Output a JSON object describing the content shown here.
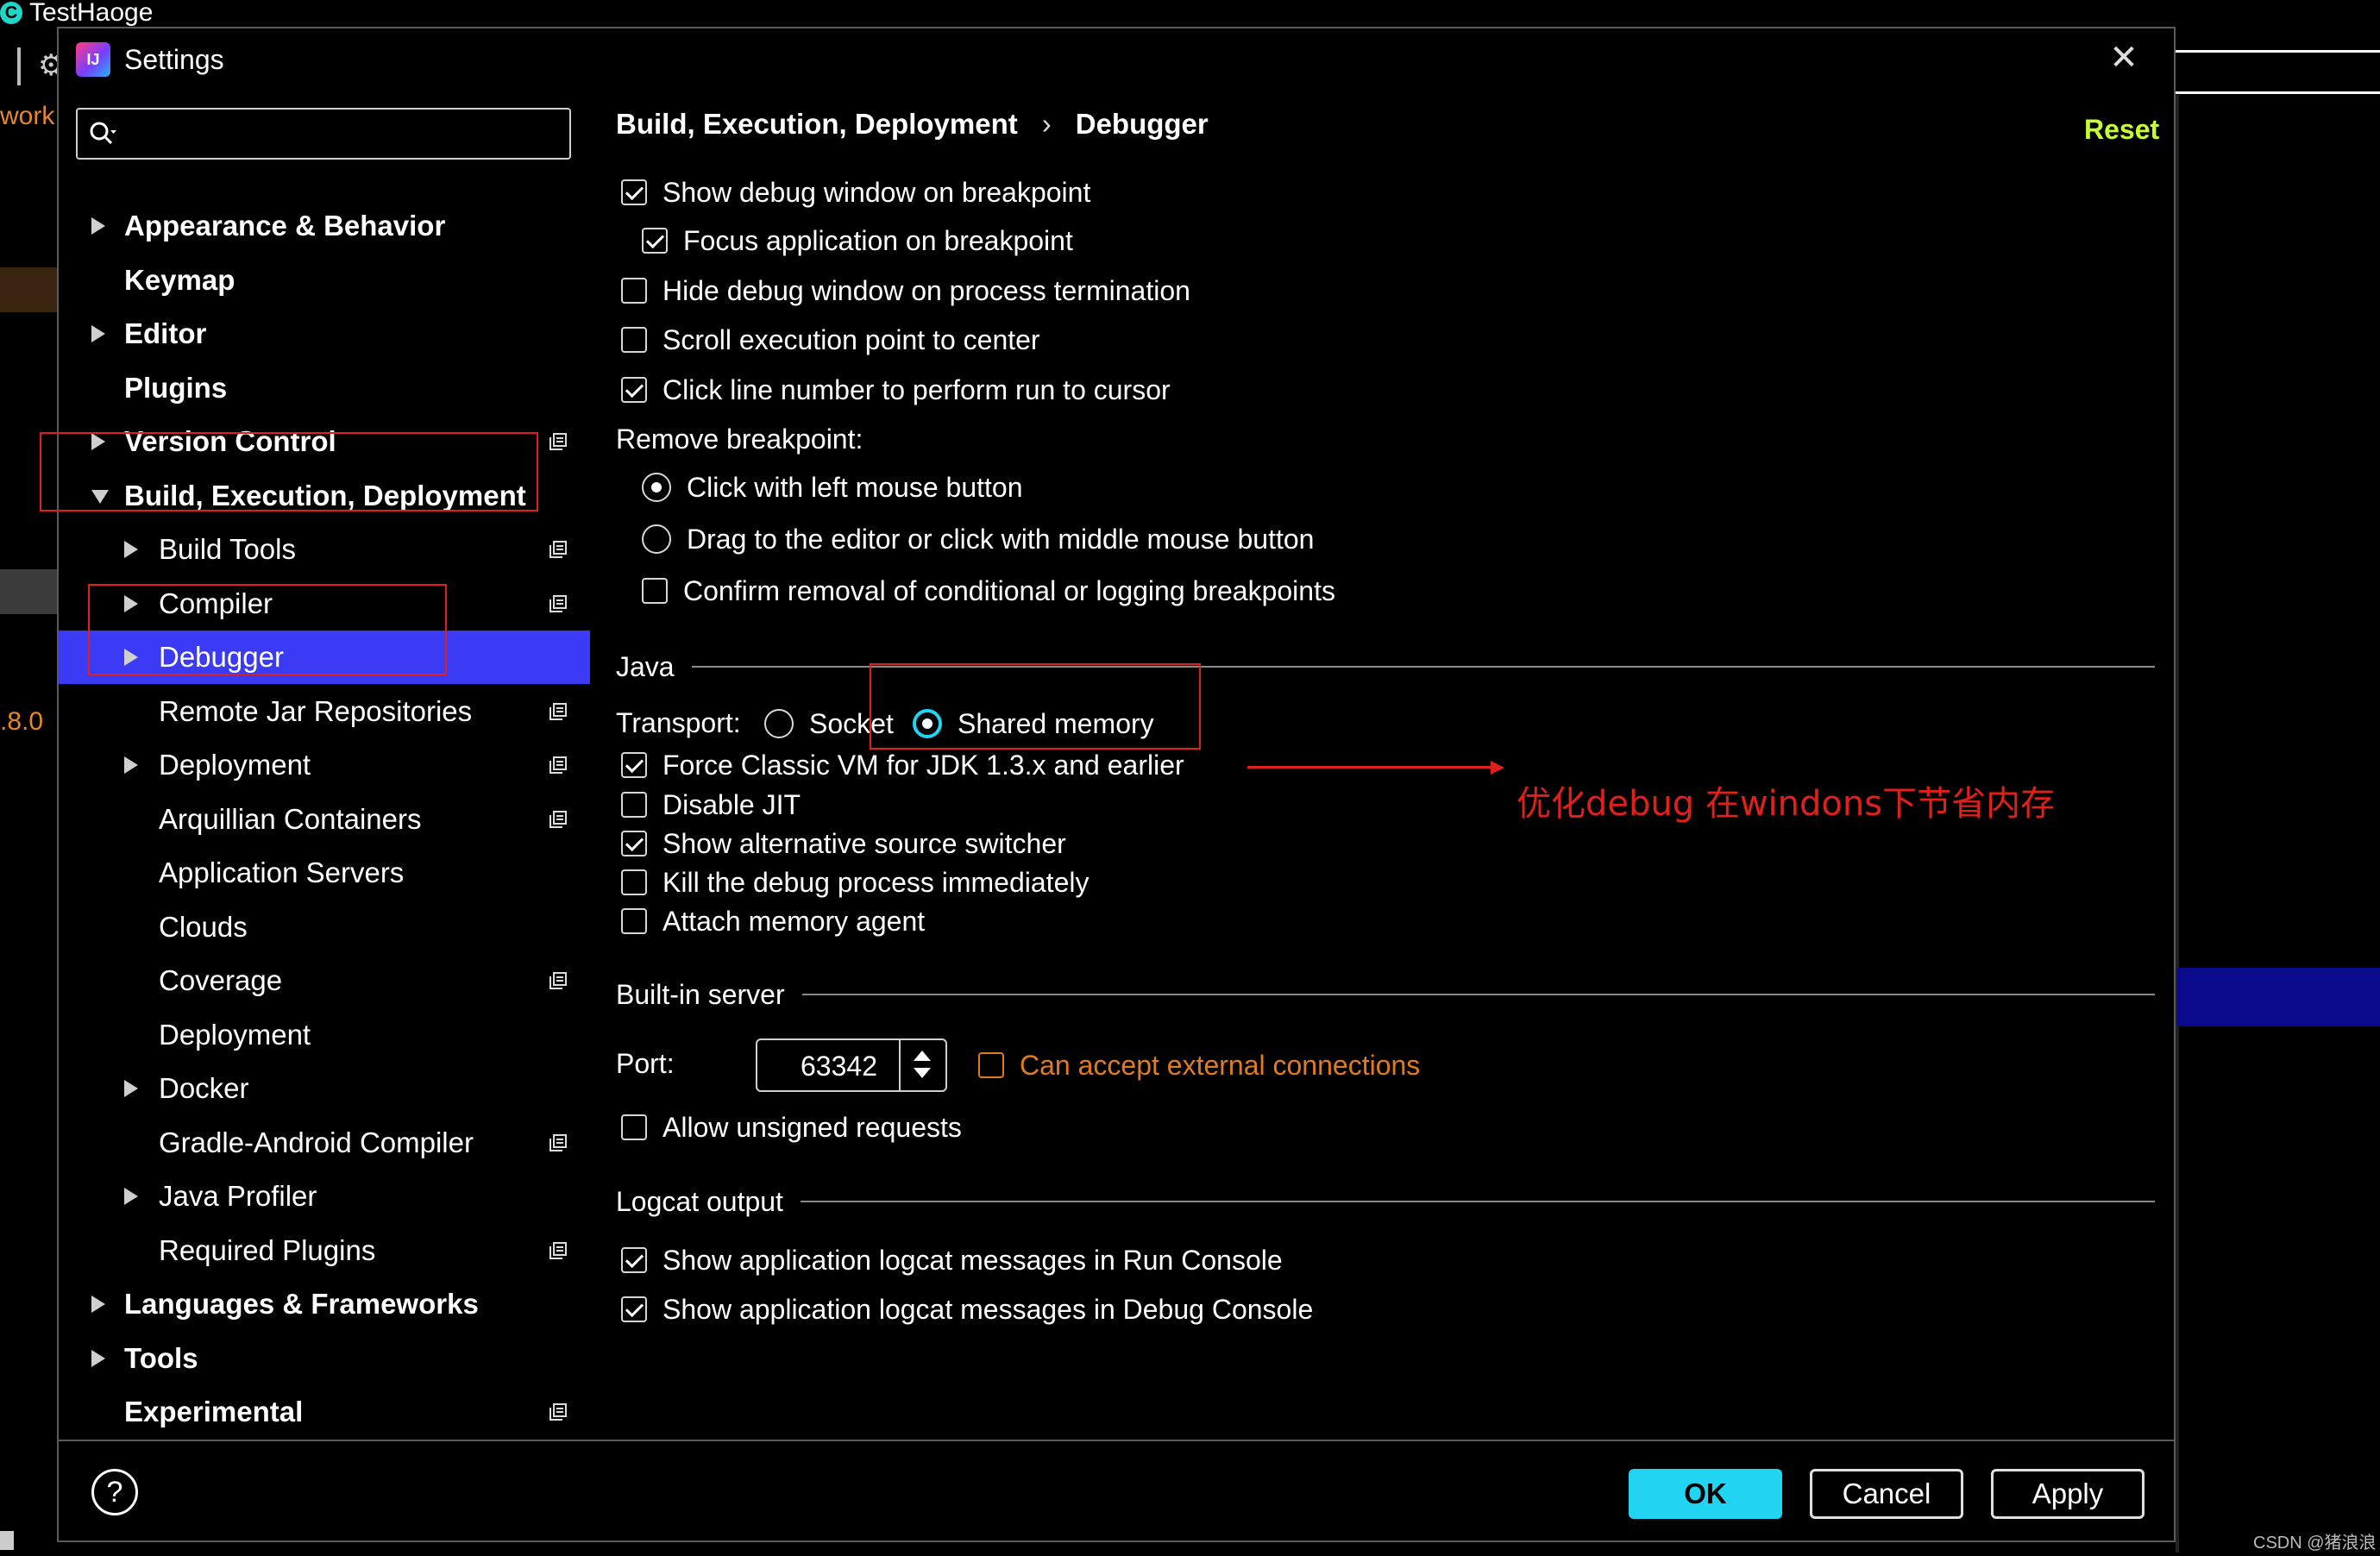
{
  "ide": {
    "title": "TestHaoge",
    "logo_letter": "C",
    "side_text_1": "work",
    "side_text_2": ".8.0"
  },
  "dialog": {
    "title": "Settings",
    "icon_text": "IJ",
    "close_glyph": "✕"
  },
  "search": {
    "placeholder": "",
    "value": ""
  },
  "tree": [
    {
      "label": "Appearance & Behavior",
      "bold": true,
      "level": 0,
      "arrow": "right",
      "copy": false
    },
    {
      "label": "Keymap",
      "bold": true,
      "level": 0,
      "arrow": "",
      "copy": false
    },
    {
      "label": "Editor",
      "bold": true,
      "level": 0,
      "arrow": "right",
      "copy": false
    },
    {
      "label": "Plugins",
      "bold": true,
      "level": 0,
      "arrow": "",
      "copy": false
    },
    {
      "label": "Version Control",
      "bold": true,
      "level": 0,
      "arrow": "right",
      "copy": true
    },
    {
      "label": "Build, Execution, Deployment",
      "bold": true,
      "level": 0,
      "arrow": "down",
      "copy": false
    },
    {
      "label": "Build Tools",
      "bold": false,
      "level": 1,
      "arrow": "right",
      "copy": true
    },
    {
      "label": "Compiler",
      "bold": false,
      "level": 1,
      "arrow": "right",
      "copy": true
    },
    {
      "label": "Debugger",
      "bold": false,
      "level": 1,
      "arrow": "right",
      "copy": false,
      "selected": true
    },
    {
      "label": "Remote Jar Repositories",
      "bold": false,
      "level": 1,
      "arrow": "",
      "copy": true
    },
    {
      "label": "Deployment",
      "bold": false,
      "level": 1,
      "arrow": "right",
      "copy": true
    },
    {
      "label": "Arquillian Containers",
      "bold": false,
      "level": 1,
      "arrow": "",
      "copy": true
    },
    {
      "label": "Application Servers",
      "bold": false,
      "level": 1,
      "arrow": "",
      "copy": false
    },
    {
      "label": "Clouds",
      "bold": false,
      "level": 1,
      "arrow": "",
      "copy": false
    },
    {
      "label": "Coverage",
      "bold": false,
      "level": 1,
      "arrow": "",
      "copy": true
    },
    {
      "label": "Deployment",
      "bold": false,
      "level": 1,
      "arrow": "",
      "copy": false
    },
    {
      "label": "Docker",
      "bold": false,
      "level": 1,
      "arrow": "right",
      "copy": false
    },
    {
      "label": "Gradle-Android Compiler",
      "bold": false,
      "level": 1,
      "arrow": "",
      "copy": true
    },
    {
      "label": "Java Profiler",
      "bold": false,
      "level": 1,
      "arrow": "right",
      "copy": false
    },
    {
      "label": "Required Plugins",
      "bold": false,
      "level": 1,
      "arrow": "",
      "copy": true
    },
    {
      "label": "Languages & Frameworks",
      "bold": true,
      "level": 0,
      "arrow": "right",
      "copy": false
    },
    {
      "label": "Tools",
      "bold": true,
      "level": 0,
      "arrow": "right",
      "copy": false
    },
    {
      "label": "Experimental",
      "bold": true,
      "level": 0,
      "arrow": "",
      "copy": true
    }
  ],
  "breadcrumb": {
    "parent": "Build, Execution, Deployment",
    "separator": "›",
    "current": "Debugger"
  },
  "reset_label": "Reset",
  "debugger": {
    "show_debug_window": {
      "label": "Show debug window on breakpoint",
      "checked": true
    },
    "focus_app": {
      "label": "Focus application on breakpoint",
      "checked": true
    },
    "hide_debug_window": {
      "label": "Hide debug window on process termination",
      "checked": false
    },
    "scroll_center": {
      "label": "Scroll execution point to center",
      "checked": false
    },
    "click_line_number": {
      "label": "Click line number to perform run to cursor",
      "checked": true
    },
    "remove_breakpoint_label": "Remove breakpoint:",
    "remove_left_click": {
      "label": "Click with left mouse button",
      "selected": true
    },
    "remove_drag": {
      "label": "Drag to the editor or click with middle mouse button",
      "selected": false
    },
    "confirm_removal": {
      "label": "Confirm removal of conditional or logging breakpoints",
      "checked": false
    }
  },
  "java": {
    "section": "Java",
    "transport_label": "Transport:",
    "socket": {
      "label": "Socket",
      "selected": false
    },
    "shared_memory": {
      "label": "Shared memory",
      "selected": true
    },
    "force_classic_vm": {
      "label": "Force Classic VM for JDK 1.3.x and earlier",
      "checked": true
    },
    "disable_jit": {
      "label": "Disable JIT",
      "checked": false
    },
    "alt_source_switcher": {
      "label": "Show alternative source switcher",
      "checked": true
    },
    "kill_debug": {
      "label": "Kill the debug process immediately",
      "checked": false
    },
    "attach_memory_agent": {
      "label": "Attach memory agent",
      "checked": false
    }
  },
  "server": {
    "section": "Built-in server",
    "port_label": "Port:",
    "port_value": "63342",
    "external_connections": {
      "label": "Can accept external connections",
      "checked": false
    },
    "unsigned_requests": {
      "label": "Allow unsigned requests",
      "checked": false
    }
  },
  "logcat": {
    "section": "Logcat output",
    "run_console": {
      "label": "Show application logcat messages in Run Console",
      "checked": true
    },
    "debug_console": {
      "label": "Show application logcat messages in Debug Console",
      "checked": true
    }
  },
  "annotation": "优化debug  在windons下节省内存",
  "footer": {
    "help": "?",
    "ok": "OK",
    "cancel": "Cancel",
    "apply": "Apply"
  },
  "watermark": "CSDN @猪浪浪",
  "colors": {
    "selection": "#3b3bf5",
    "accent": "#21d4f2",
    "reset": "#c6ff33",
    "annotation_red": "#e0201a",
    "orange": "#e07c1e"
  }
}
